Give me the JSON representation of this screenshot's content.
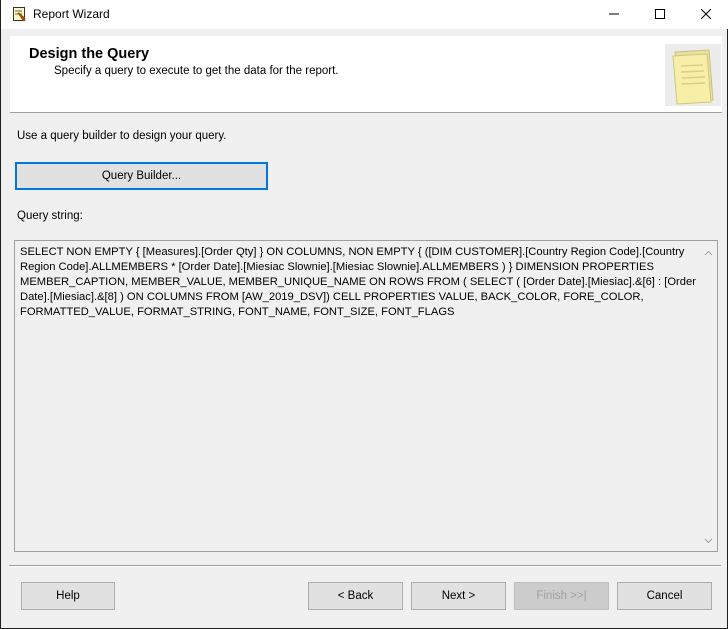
{
  "window": {
    "title": "Report Wizard"
  },
  "header": {
    "title": "Design the Query",
    "subtitle": "Specify a query to execute to get the data for the report."
  },
  "body": {
    "instruction": "Use a query builder to design your query.",
    "query_builder_label": "Query Builder...",
    "query_string_label": "Query string:",
    "query_string": " SELECT NON EMPTY { [Measures].[Order Qty] } ON COLUMNS, NON EMPTY { ([DIM CUSTOMER].[Country Region Code].[Country Region Code].ALLMEMBERS * [Order Date].[Miesiac Slownie].[Miesiac Slownie].ALLMEMBERS ) } DIMENSION PROPERTIES MEMBER_CAPTION, MEMBER_VALUE, MEMBER_UNIQUE_NAME ON ROWS FROM ( SELECT ( [Order Date].[Miesiac].&[6] : [Order Date].[Miesiac].&[8] ) ON COLUMNS FROM [AW_2019_DSV]) CELL PROPERTIES VALUE, BACK_COLOR, FORE_COLOR, FORMATTED_VALUE, FORMAT_STRING, FONT_NAME, FONT_SIZE, FONT_FLAGS"
  },
  "footer": {
    "help_label": "Help",
    "back_label": "< Back",
    "next_label": "Next >",
    "finish_label": "Finish >>|",
    "cancel_label": "Cancel"
  },
  "colors": {
    "focus_border": "#0078d7",
    "button_face": "#e1e1e1",
    "dialog_background": "#f0f0f0"
  },
  "icons": [
    "report-wizard-app-icon",
    "minimize-icon",
    "maximize-icon",
    "close-icon",
    "wizard-document-art",
    "scroll-up-icon",
    "scroll-down-icon"
  ]
}
